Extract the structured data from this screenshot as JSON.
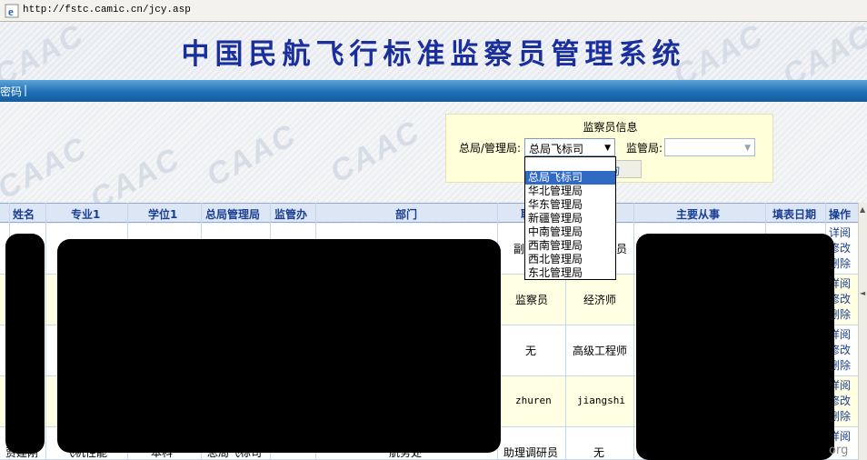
{
  "address_bar": {
    "url": "http://fstc.camic.cn/jcy.asp"
  },
  "banner": {
    "title": "中国民航飞行标准监察员管理系统",
    "watermark": "CAAC"
  },
  "nav": {
    "item": "密码",
    "separator": "|"
  },
  "search_panel": {
    "title": "监察员信息",
    "bureau_label": "总局/管理局:",
    "bureau_selected": "总局飞标司",
    "office_label": "监管局:",
    "office_selected": "",
    "query_button": "询",
    "bureau_options": [
      "总局飞标司",
      "华北管理局",
      "华东管理局",
      "新疆管理局",
      "中南管理局",
      "西南管理局",
      "西北管理局",
      "东北管理局"
    ]
  },
  "table": {
    "headers": {
      "name": "姓名",
      "major": "专业1",
      "degree": "学位1",
      "bureau": "总局管理局",
      "office": "监管办",
      "dept": "部门",
      "duty": "职",
      "title": "",
      "main_work": "主要从事",
      "date": "填表日期",
      "ops": "操作"
    },
    "rows": [
      {
        "name": "",
        "major": "",
        "degree": "",
        "bureau": "",
        "dept": "",
        "duty": "副",
        "title": "员"
      },
      {
        "name": "",
        "major": "",
        "degree": "",
        "bureau": "",
        "dept": "",
        "duty": "监察员",
        "title": "经济师"
      },
      {
        "name": "",
        "major": "",
        "degree": "",
        "bureau": "",
        "dept": "",
        "duty": "无",
        "title": "高级工程师"
      },
      {
        "name": "",
        "major": "",
        "degree": "",
        "bureau": "",
        "dept": "",
        "duty": "zhuren",
        "title": "jiangshi"
      },
      {
        "name": "贾建刚",
        "major": "飞机性能",
        "degree": "本科",
        "bureau": "总局飞标司",
        "dept": "航务处",
        "duty": "助理调研员",
        "title": "无"
      }
    ],
    "ops": {
      "view": "详阅",
      "edit": "修改",
      "delete": "删除"
    }
  },
  "corner_text": "org"
}
